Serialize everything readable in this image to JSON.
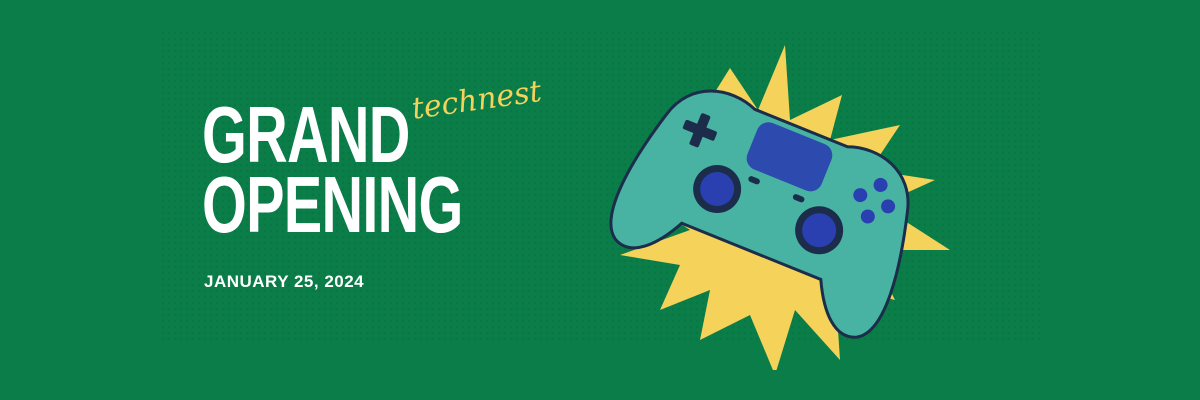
{
  "banner": {
    "headline_line1": "GRAND",
    "headline_line2": "OPENING",
    "date": "JANUARY 25, 2024",
    "brand": "technest"
  },
  "colors": {
    "background": "#0a7d48",
    "headline": "#ffffff",
    "brand": "#f5d35a",
    "starburst": "#f5d35a",
    "controller_body": "#49b3a3",
    "controller_accent": "#2a3fb0"
  },
  "icons": {
    "illustration": "game-controller-icon",
    "burst": "starburst-icon"
  }
}
